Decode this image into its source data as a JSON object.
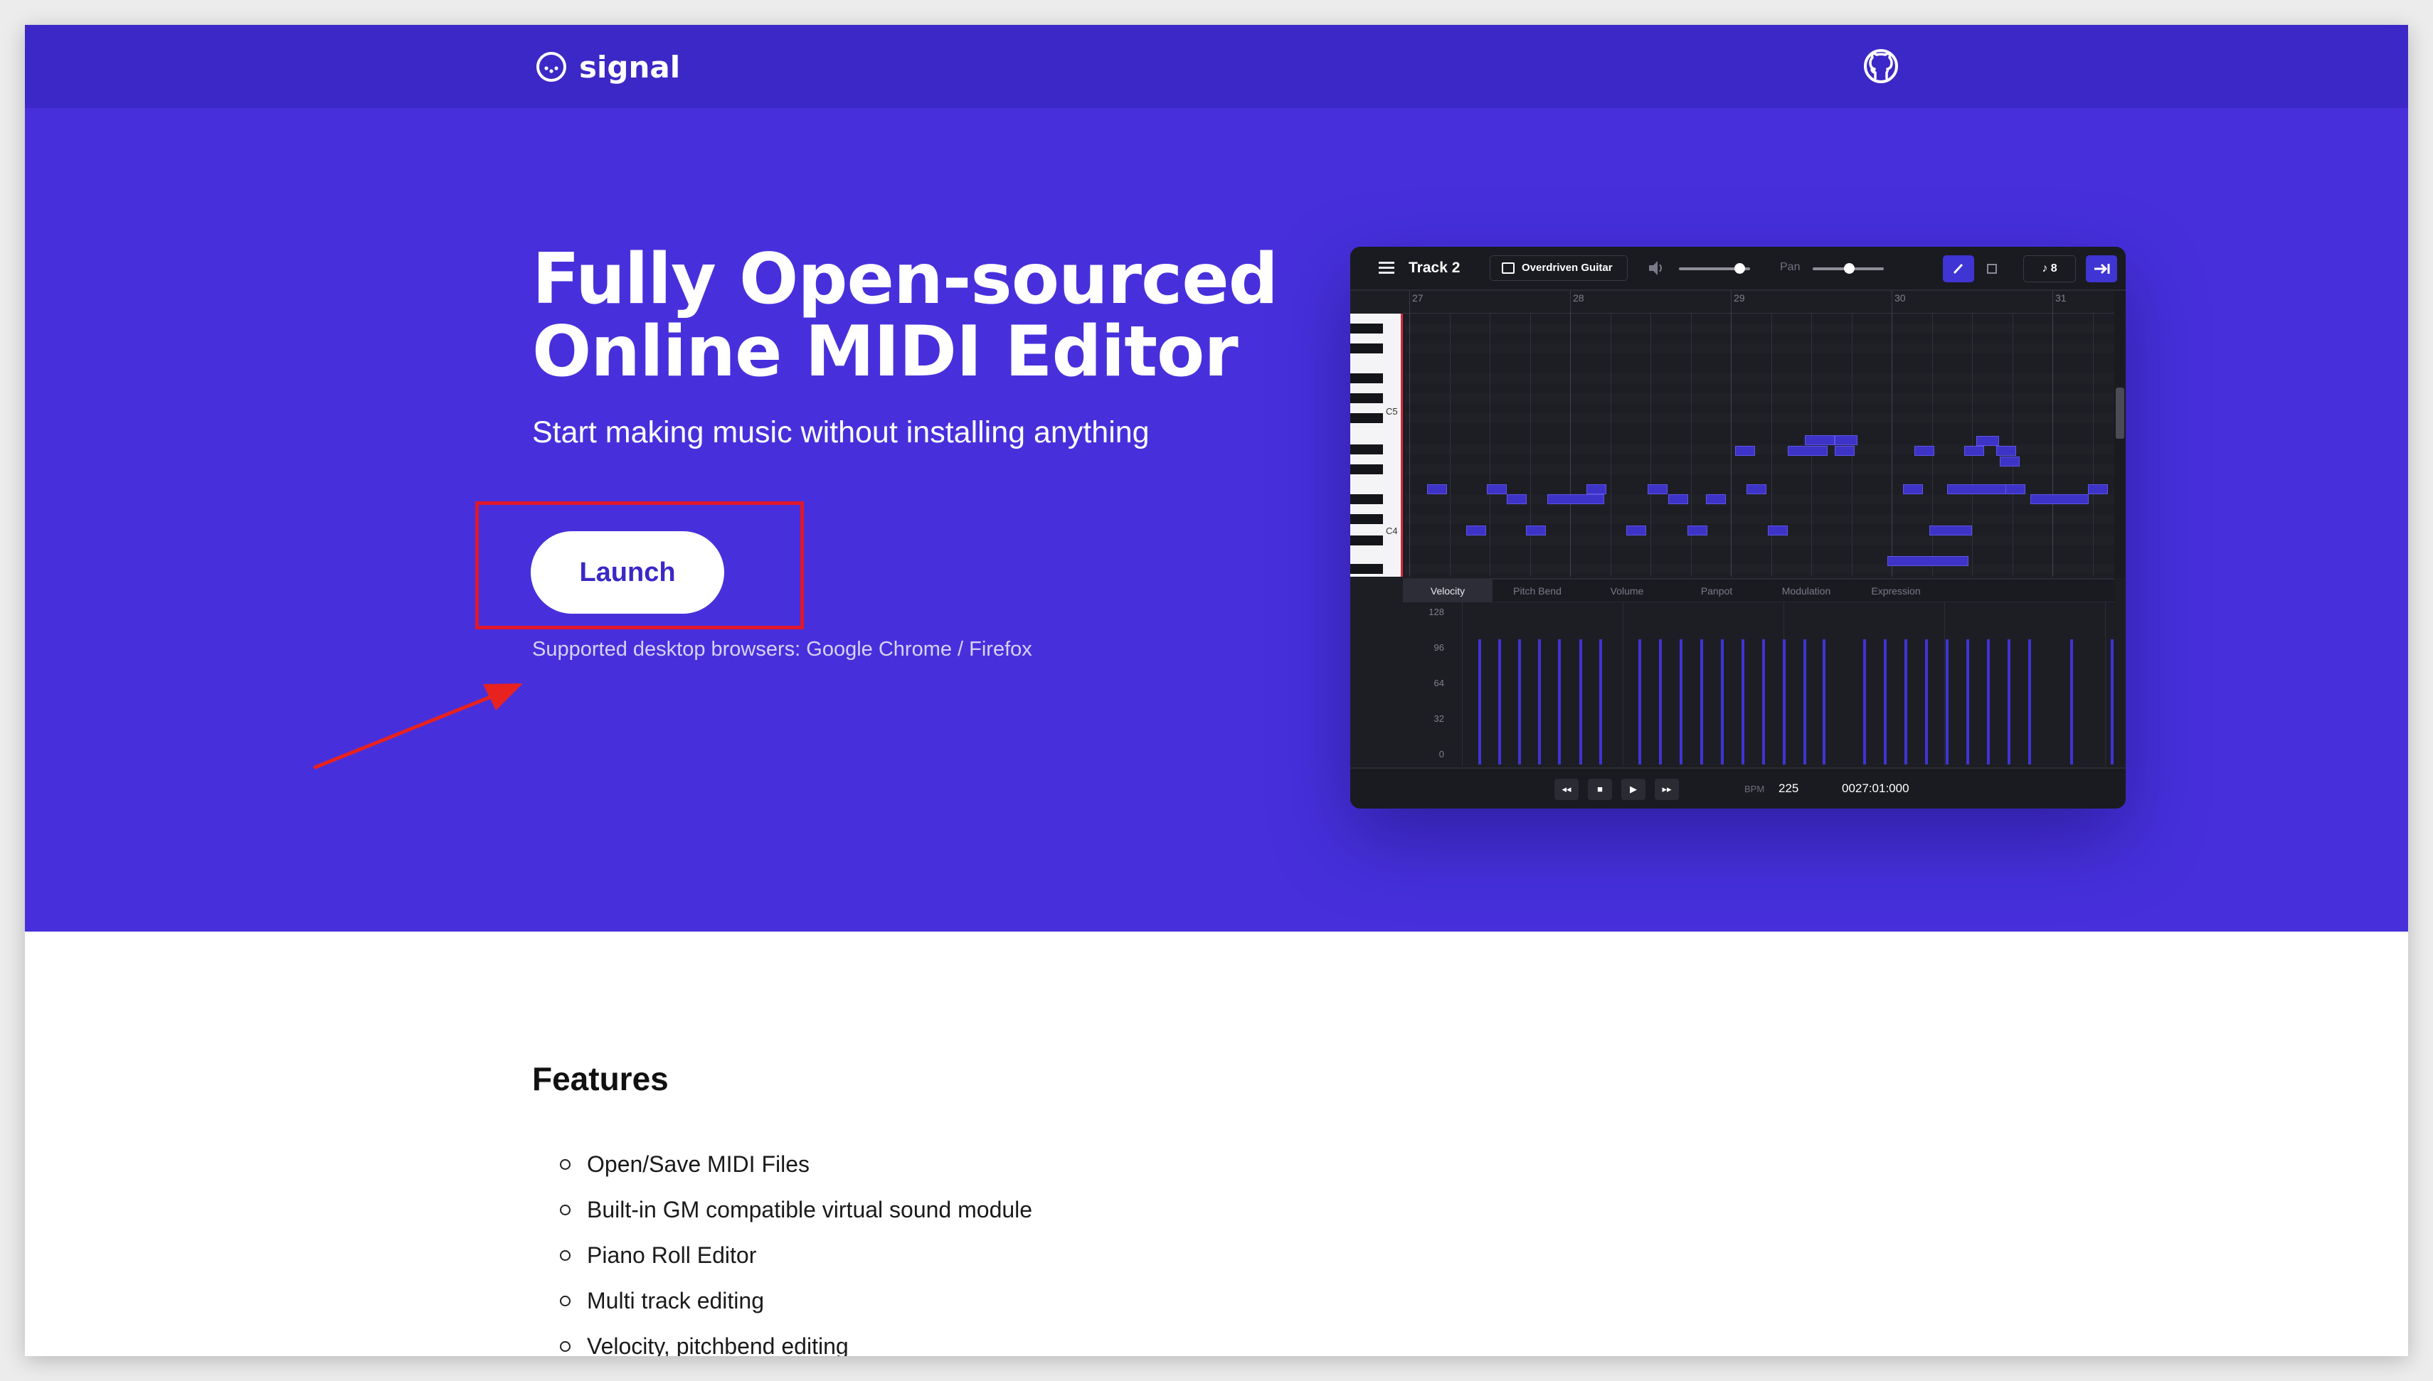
{
  "brand": {
    "name": "signal"
  },
  "hero": {
    "headline_line1": "Fully Open-sourced",
    "headline_line2": "Online MIDI Editor",
    "subheadline": "Start making music without installing anything",
    "launch_label": "Launch",
    "browsers_note": "Supported desktop browsers: Google Chrome / Firefox"
  },
  "preview": {
    "track_name": "Track 2",
    "instrument": "Overdriven Guitar",
    "pan_label": "Pan",
    "quantize": "8",
    "ruler_labels": [
      "27",
      "28",
      "29",
      "30",
      "31"
    ],
    "key_labels": [
      "C5",
      "C4"
    ],
    "control_tabs": [
      "Velocity",
      "Pitch Bend",
      "Volume",
      "Panpot",
      "Modulation",
      "Expression"
    ],
    "velocity_axis": [
      "128",
      "96",
      "64",
      "32",
      "0"
    ],
    "bpm_label": "BPM",
    "bpm": "225",
    "time": "0027:01:000"
  },
  "features": {
    "title": "Features",
    "items": [
      "Open/Save MIDI Files",
      "Built-in GM compatible virtual sound module",
      "Piano Roll Editor",
      "Multi track editing",
      "Velocity, pitchbend editing"
    ]
  },
  "colors": {
    "header": "#3b28c6",
    "hero": "#4730dc",
    "accent_text": "#3b28c6",
    "annotation": "#e0182a"
  }
}
